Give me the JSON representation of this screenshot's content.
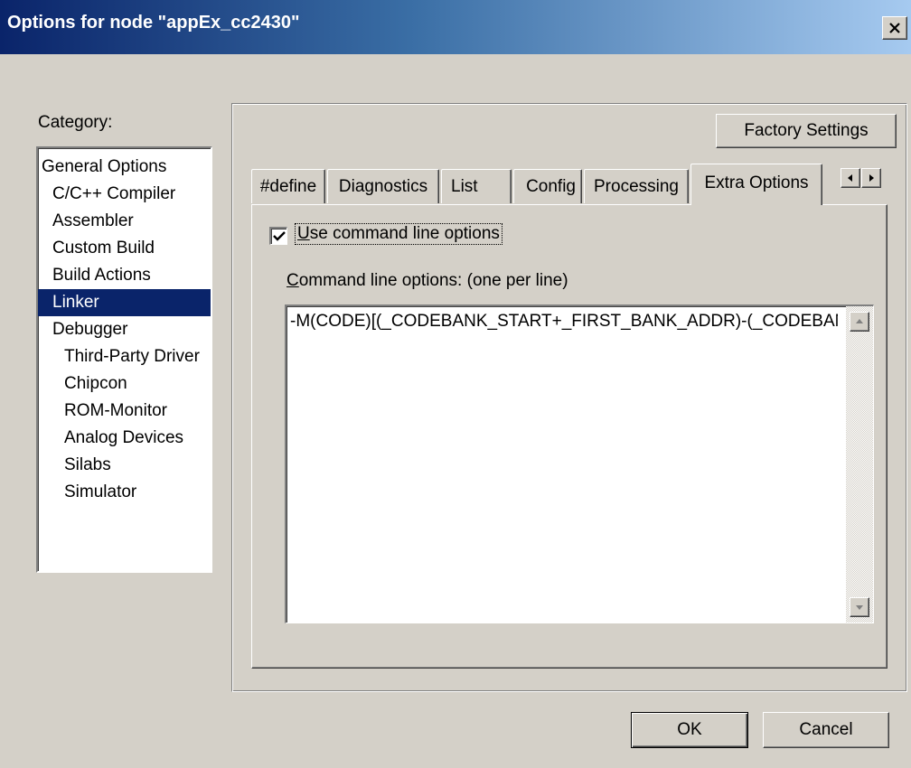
{
  "window": {
    "title": "Options for node \"appEx_cc2430\""
  },
  "category": {
    "label": "Category:",
    "items": [
      {
        "label": "General Options"
      },
      {
        "label": "C/C++ Compiler"
      },
      {
        "label": "Assembler"
      },
      {
        "label": "Custom Build"
      },
      {
        "label": "Build Actions"
      },
      {
        "label": "Linker",
        "selected": true
      },
      {
        "label": "Debugger"
      },
      {
        "label": "Third-Party Driver"
      },
      {
        "label": "Chipcon"
      },
      {
        "label": "ROM-Monitor"
      },
      {
        "label": "Analog Devices"
      },
      {
        "label": "Silabs"
      },
      {
        "label": "Simulator"
      }
    ]
  },
  "buttons": {
    "factory_settings": "Factory Settings",
    "ok": "OK",
    "cancel": "Cancel"
  },
  "tabs": [
    {
      "label": "#define"
    },
    {
      "label": "Diagnostics"
    },
    {
      "label": "List"
    },
    {
      "label": "Config"
    },
    {
      "label": "Processing"
    },
    {
      "label": "Extra Options",
      "active": true
    }
  ],
  "extra_options": {
    "use_cmdline_label_mnemonic": "U",
    "use_cmdline_label_rest": "se command line options",
    "use_cmdline_checked": true,
    "cmd_label_mnemonic": "C",
    "cmd_label_rest": "ommand line options:  (one per line)",
    "cmd_text": "-M(CODE)[(_CODEBANK_START+_FIRST_BANK_ADDR)-(_CODEBANK_END+_FIRST_BANK_ADDR)]"
  },
  "icons": {
    "close": "close-icon",
    "tab_scroll_left": "arrow-left-icon",
    "tab_scroll_right": "arrow-right-icon",
    "scroll_up": "arrow-up-icon",
    "scroll_down": "arrow-down-icon",
    "check": "checkmark-icon"
  },
  "colors": {
    "dialog_background": "#d4d0c8",
    "title_bar_start": "#0a246a",
    "title_bar_end": "#a6caf0",
    "selection": "#0a246a"
  }
}
